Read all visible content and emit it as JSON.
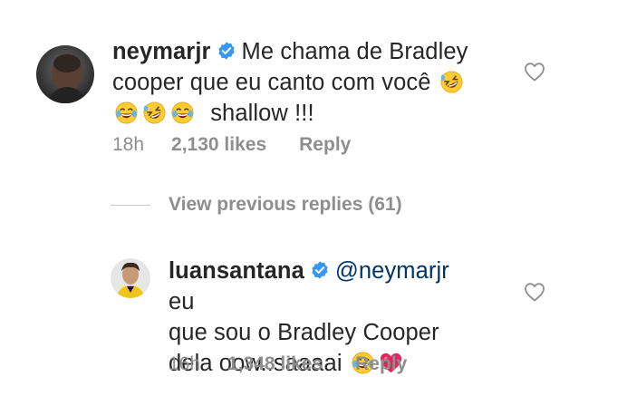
{
  "comments": [
    {
      "username": "neymarjr",
      "verified": true,
      "text_line1": "Me chama de Bradley",
      "text_line2": "cooper que eu canto com você",
      "text_line3": "shallow !!!",
      "timestamp": "18h",
      "likes": "2,130 likes",
      "reply_label": "Reply"
    },
    {
      "username": "luansantana",
      "verified": true,
      "mention": "@neymarjr",
      "text_line1": "eu",
      "text_line2": "que sou o Bradley Cooper",
      "text_line3": "dela oow..saaaai",
      "timestamp": "16h",
      "likes": "1,348 likes",
      "reply_label": "Reply"
    }
  ],
  "view_previous_replies": "View previous replies (61)",
  "colors": {
    "text": "#262626",
    "secondary": "#8e8e8e",
    "verified": "#3897f0",
    "mention": "#003569",
    "heart": "#e0245e"
  },
  "icons": [
    "verified-badge-icon",
    "heart-outline-icon",
    "rofl-emoji",
    "joy-emoji",
    "red-heart-emoji"
  ]
}
